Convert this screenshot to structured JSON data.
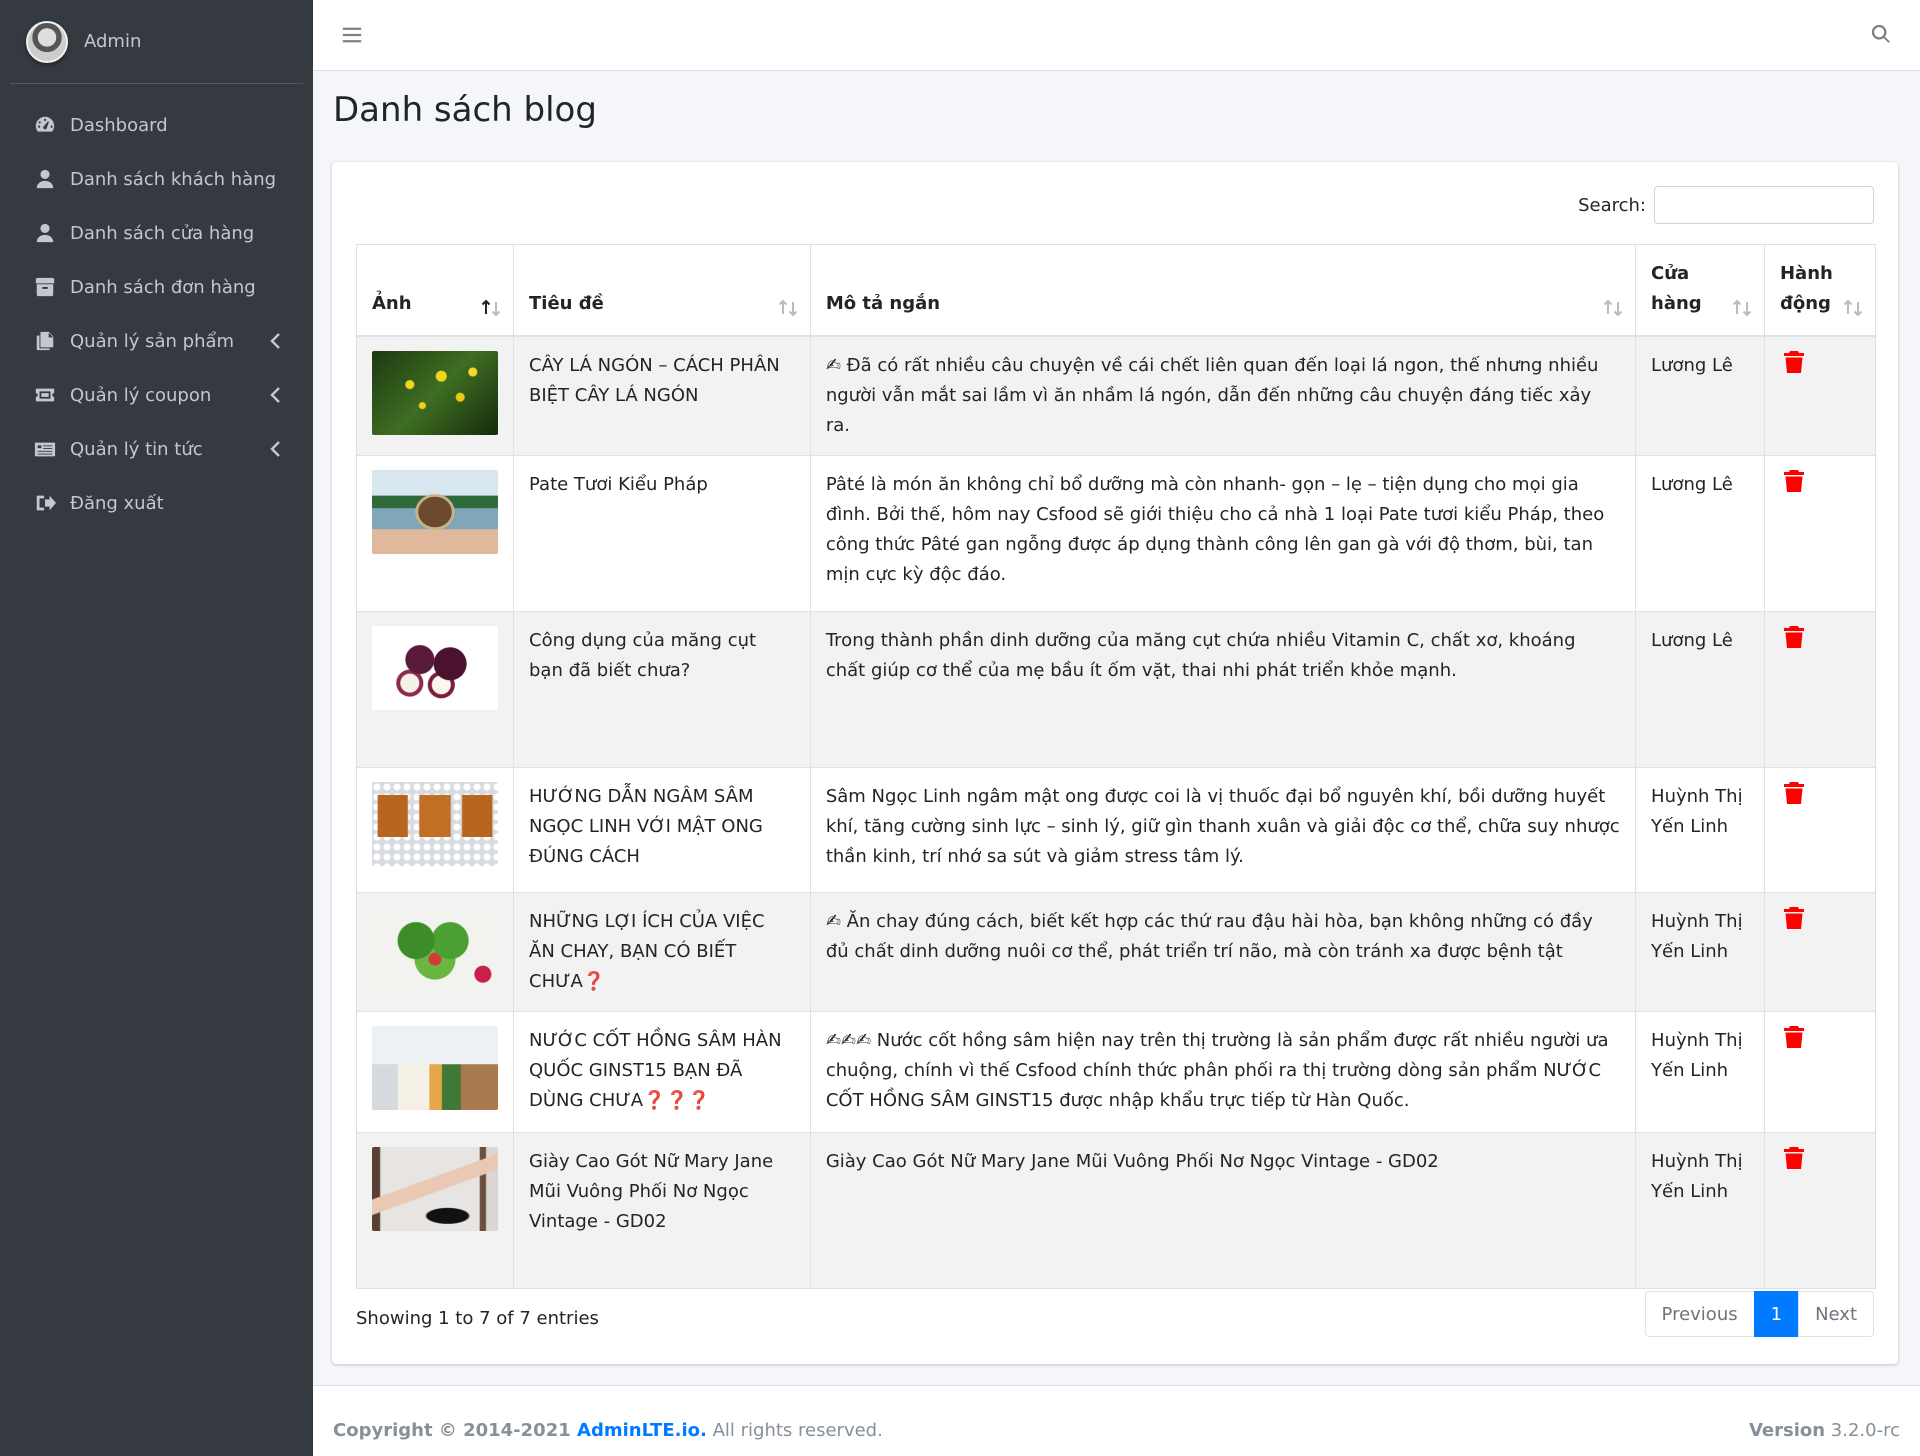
{
  "user": {
    "name": "Admin"
  },
  "sidebar": {
    "items": [
      {
        "label": "Dashboard",
        "icon": "tachometer-icon",
        "has_caret": false
      },
      {
        "label": "Danh sách khách hàng",
        "icon": "user-icon",
        "has_caret": false
      },
      {
        "label": "Danh sách cửa hàng",
        "icon": "user-icon",
        "has_caret": false
      },
      {
        "label": "Danh sách đơn hàng",
        "icon": "box-icon",
        "has_caret": false
      },
      {
        "label": "Quản lý sản phẩm",
        "icon": "copy-icon",
        "has_caret": true
      },
      {
        "label": "Quản lý coupon",
        "icon": "ticket-icon",
        "has_caret": true
      },
      {
        "label": "Quản lý tin tức",
        "icon": "newspaper-icon",
        "has_caret": true
      },
      {
        "label": "Đăng xuất",
        "icon": "sign-out-icon",
        "has_caret": false
      }
    ]
  },
  "page": {
    "title": "Danh sách blog"
  },
  "search": {
    "label": "Search:",
    "value": ""
  },
  "table": {
    "headers": [
      "Ảnh",
      "Tiêu đề",
      "Mô tả ngắn",
      "Cửa hàng",
      "Hành động"
    ],
    "rows": [
      {
        "image": "yellow-flowers-photo",
        "title": "CÂY LÁ NGÓN – CÁCH PHÂN BIỆT CÂY LÁ NGÓN",
        "desc": "✍ Đã có rất nhiều câu chuyện về cái chết liên quan đến loại lá ngon, thế nhưng nhiều người vẫn mắt sai lầm vì ăn nhầm lá ngón, dẫn đến những câu chuyện đáng tiếc xảy ra.",
        "store": "Lương Lê"
      },
      {
        "image": "pate-jar-photo",
        "title": "Pate Tươi Kiểu Pháp",
        "desc": "Pâté là món ăn không chỉ bổ dưỡng mà còn nhanh- gọn – lẹ – tiện dụng cho mọi gia đình. Bởi thế, hôm nay Csfood sẽ giới thiệu cho cả nhà 1 loại Pate tươi kiểu Pháp, theo công thức Pâté gan ngỗng được áp dụng thành công lên gan gà với độ thơm, bùi, tan mịn cực kỳ độc đáo.",
        "store": "Lương Lê"
      },
      {
        "image": "mangosteen-photo",
        "title": "Công dụng của măng cụt bạn đã biết chưa?",
        "desc": "Trong thành phần dinh dưỡng của măng cụt chứa nhiều Vitamin C, chất xơ, khoáng chất giúp cơ thể của mẹ bầu ít ốm vặt, thai nhi phát triển khỏe mạnh.",
        "store": "Lương Lê"
      },
      {
        "image": "ginseng-honey-jars-photo",
        "title": "HƯỚNG DẪN NGÂM SÂM NGỌC LINH VỚI MẬT ONG ĐÚNG CÁCH",
        "desc": "Sâm Ngọc Linh ngâm mật ong được coi là vị thuốc đại bổ nguyên khí, bồi dưỡng huyết khí, tăng cường sinh lực – sinh lý, giữ gìn thanh xuân và giải độc cơ thể, chữa suy nhược thần kinh, trí nhớ sa sút và giảm stress tâm lý.",
        "store": "Huỳnh Thị Yến Linh"
      },
      {
        "image": "vegetable-heart-photo",
        "title": "NHỮNG LỢI ÍCH CỦA VIỆC ĂN CHAY, BẠN CÓ BIẾT CHƯA❓",
        "desc": "✍ Ăn chay đúng cách, biết kết hợp các thứ rau đậu hài hòa, bạn không những có đầy đủ chất dinh dưỡng nuôi cơ thể, phát triển trí não, mà còn tránh xa được bệnh tật",
        "store": "Huỳnh Thị Yến Linh"
      },
      {
        "image": "ginseng-drink-photo",
        "title": "NƯỚC CỐT HỒNG SÂM HÀN QUỐC GINST15 BẠN ĐÃ DÙNG CHƯA❓❓❓",
        "desc": "✍✍✍ Nước cốt hồng sâm hiện nay trên thị trường là sản phẩm được rất nhiều người ưa chuộng, chính vì thế Csfood chính thức phân phối ra thị trường dòng sản phẩm NƯỚC CỐT HỒNG SÂM GINST15 được nhập khẩu trực tiếp từ Hàn Quốc.",
        "store": "Huỳnh Thị Yến Linh"
      },
      {
        "image": "high-heel-shoes-photo",
        "title": "Giày Cao Gót Nữ Mary Jane Mũi Vuông Phối Nơ Ngọc Vintage - GD02",
        "desc": "Giày Cao Gót Nữ Mary Jane Mũi Vuông Phối Nơ Ngọc Vintage - GD02",
        "store": "Huỳnh Thị Yến Linh"
      }
    ]
  },
  "pagination": {
    "info": "Showing 1 to 7 of 7 entries",
    "previous": "Previous",
    "current": "1",
    "next": "Next"
  },
  "footer": {
    "copyright": "Copyright © 2014-2021 ",
    "brand": "AdminLTE.io.",
    "rights": " All rights reserved.",
    "version_label": "Version",
    "version": "3.2.0-rc"
  },
  "colors": {
    "sidebar_bg": "#343a40",
    "accent": "#007bff",
    "delete": "#ff0000"
  }
}
